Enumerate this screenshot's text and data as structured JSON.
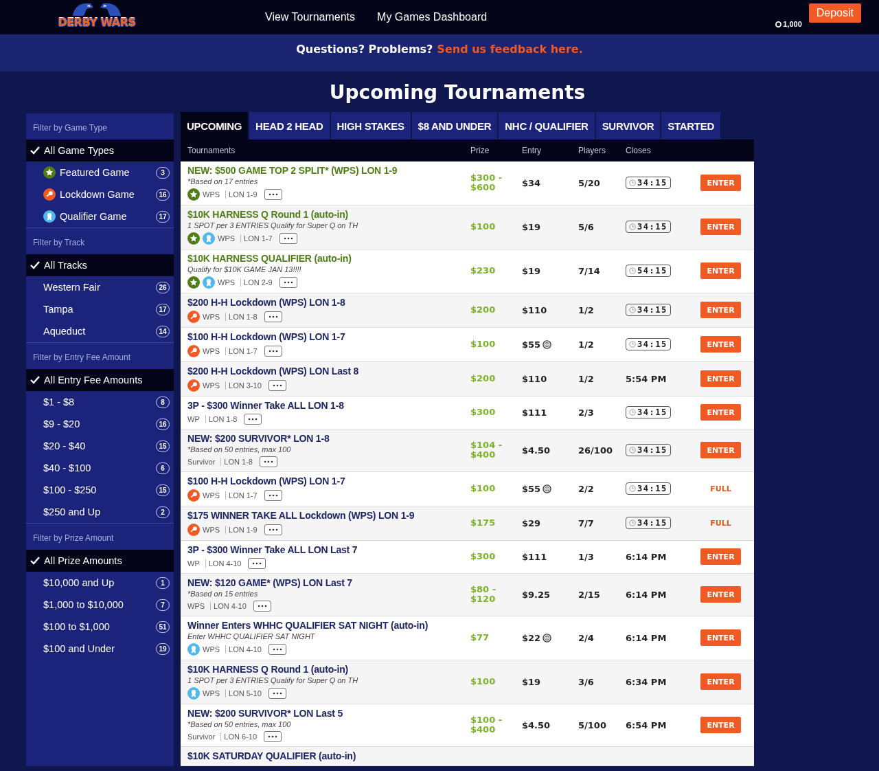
{
  "header": {
    "logo": "DERBY WARS",
    "nav": [
      "View Tournaments",
      "My Games Dashboard"
    ],
    "balance": "1,000",
    "deposit": "Deposit"
  },
  "banner": {
    "question": "Questions? Problems?",
    "link": "Send us feedback here."
  },
  "title": "Upcoming Tournaments",
  "sidebar": [
    {
      "heading": "Filter by Game Type",
      "items": [
        {
          "label": "All Game Types",
          "selected": true
        },
        {
          "label": "Featured Game",
          "kind": "featured",
          "count": "3",
          "selected": false
        },
        {
          "label": "Lockdown Game",
          "kind": "lockdown",
          "count": "16",
          "selected": false
        },
        {
          "label": "Qualifier Game",
          "kind": "qualifier",
          "count": "17",
          "selected": false
        }
      ]
    },
    {
      "heading": "Filter by Track",
      "items": [
        {
          "label": "All Tracks",
          "selected": true
        },
        {
          "label": "Western Fair",
          "count": "26",
          "selected": false
        },
        {
          "label": "Tampa",
          "count": "17",
          "selected": false
        },
        {
          "label": "Aqueduct",
          "count": "14",
          "selected": false
        }
      ]
    },
    {
      "heading": "Filter by Entry Fee Amount",
      "items": [
        {
          "label": "All Entry Fee Amounts",
          "selected": true
        },
        {
          "label": "$1 - $8",
          "count": "8",
          "selected": false
        },
        {
          "label": "$9 - $20",
          "count": "16",
          "selected": false
        },
        {
          "label": "$20 - $40",
          "count": "15",
          "selected": false
        },
        {
          "label": "$40 - $100",
          "count": "6",
          "selected": false
        },
        {
          "label": "$100 - $250",
          "count": "15",
          "selected": false
        },
        {
          "label": "$250 and Up",
          "count": "2",
          "selected": false
        }
      ]
    },
    {
      "heading": "Filter by Prize Amount",
      "items": [
        {
          "label": "All Prize Amounts",
          "selected": true
        },
        {
          "label": "$10,000 and Up",
          "count": "1",
          "selected": false
        },
        {
          "label": "$1,000 to $10,000",
          "count": "7",
          "selected": false
        },
        {
          "label": "$100 to $1,000",
          "count": "51",
          "selected": false
        },
        {
          "label": "$100 and Under",
          "count": "19",
          "selected": false
        }
      ]
    }
  ],
  "tabs": [
    {
      "label": "UPCOMING",
      "selected": true
    },
    {
      "label": "HEAD 2 HEAD",
      "selected": false
    },
    {
      "label": "HIGH STAKES",
      "selected": false
    },
    {
      "label": "$8 AND UNDER",
      "selected": false
    },
    {
      "label": "NHC / QUALIFIER",
      "selected": false
    },
    {
      "label": "SURVIVOR",
      "selected": false
    },
    {
      "label": "STARTED",
      "selected": false
    }
  ],
  "table": {
    "columns": [
      "Tournaments",
      "Prize",
      "Entry",
      "Players",
      "Closes"
    ],
    "rows": [
      {
        "title": "NEW: $500 GAME TOP 2 SPLIT* (WPS) LON 1-9",
        "featured": true,
        "note": "*Based on 17 entries",
        "badges": [
          {
            "kind": "featured"
          }
        ],
        "tags": [
          "WPS",
          "LON 1-9"
        ],
        "prize": "$300 - $600",
        "entry": "$34",
        "coin": false,
        "players": "5/20",
        "closes": {
          "kind": "countdown",
          "text": "34:15"
        },
        "action": {
          "kind": "enter",
          "label": "ENTER"
        }
      },
      {
        "title": "$10K HARNESS Q Round 1 (auto-in)",
        "featured": true,
        "note": "1 SPOT per 3 ENTRIES Qualify for Super Q on TH",
        "badges": [
          {
            "kind": "featured"
          },
          {
            "kind": "qualifier"
          }
        ],
        "tags": [
          "WPS",
          "LON 1-7"
        ],
        "prize": "$100",
        "entry": "$19",
        "coin": false,
        "players": "5/6",
        "closes": {
          "kind": "countdown",
          "text": "34:15"
        },
        "action": {
          "kind": "enter",
          "label": "ENTER"
        }
      },
      {
        "title": "$10K HARNESS QUALIFIER (auto-in)",
        "featured": true,
        "note": "Qualify for $10K GAME JAN 13!!!!",
        "badges": [
          {
            "kind": "featured"
          },
          {
            "kind": "qualifier"
          }
        ],
        "tags": [
          "WPS",
          "LON 2-9"
        ],
        "prize": "$230",
        "entry": "$19",
        "coin": false,
        "players": "7/14",
        "closes": {
          "kind": "countdown",
          "text": "54:15"
        },
        "action": {
          "kind": "enter",
          "label": "ENTER"
        }
      },
      {
        "title": "$200 H-H Lockdown (WPS) LON 1-8",
        "featured": false,
        "badges": [
          {
            "kind": "lockdown"
          }
        ],
        "tags": [
          "WPS",
          "LON 1-8"
        ],
        "prize": "$200",
        "entry": "$110",
        "coin": false,
        "players": "1/2",
        "closes": {
          "kind": "countdown",
          "text": "34:15"
        },
        "action": {
          "kind": "enter",
          "label": "ENTER"
        }
      },
      {
        "title": "$100 H-H Lockdown (WPS) LON 1-7",
        "featured": false,
        "badges": [
          {
            "kind": "lockdown"
          }
        ],
        "tags": [
          "WPS",
          "LON 1-7"
        ],
        "prize": "$100",
        "entry": "$55",
        "coin": true,
        "players": "1/2",
        "closes": {
          "kind": "countdown",
          "text": "34:15"
        },
        "action": {
          "kind": "enter",
          "label": "ENTER"
        }
      },
      {
        "title": "$200 H-H Lockdown (WPS) LON Last 8",
        "featured": false,
        "badges": [
          {
            "kind": "lockdown"
          }
        ],
        "tags": [
          "WPS",
          "LON 3-10"
        ],
        "prize": "$200",
        "entry": "$110",
        "coin": false,
        "players": "1/2",
        "closes": {
          "kind": "time",
          "text": "5:54 PM"
        },
        "action": {
          "kind": "enter",
          "label": "ENTER"
        }
      },
      {
        "title": "3P - $300 Winner Take ALL LON 1-8",
        "featured": false,
        "badges": [],
        "tags": [
          "WP",
          "LON 1-8"
        ],
        "prize": "$300",
        "entry": "$111",
        "coin": false,
        "players": "2/3",
        "closes": {
          "kind": "countdown",
          "text": "34:15"
        },
        "action": {
          "kind": "enter",
          "label": "ENTER"
        }
      },
      {
        "title": "NEW: $200 SURVIVOR* LON 1-8",
        "featured": false,
        "note": "*Based on 50 entries, max 100",
        "badges": [],
        "tags": [
          "Survivor",
          "LON 1-8"
        ],
        "prize": "$104 - $400",
        "entry": "$4.50",
        "coin": false,
        "players": "26/100",
        "closes": {
          "kind": "countdown",
          "text": "34:15"
        },
        "action": {
          "kind": "enter",
          "label": "ENTER"
        }
      },
      {
        "title": "$100 H-H Lockdown (WPS) LON 1-7",
        "featured": false,
        "badges": [
          {
            "kind": "lockdown"
          }
        ],
        "tags": [
          "WPS",
          "LON 1-7"
        ],
        "prize": "$100",
        "entry": "$55",
        "coin": true,
        "players": "2/2",
        "closes": {
          "kind": "countdown",
          "text": "34:15"
        },
        "action": {
          "kind": "full",
          "label": "FULL"
        }
      },
      {
        "title": "$175 WINNER TAKE ALL Lockdown (WPS) LON 1-9",
        "featured": false,
        "badges": [
          {
            "kind": "lockdown"
          }
        ],
        "tags": [
          "WPS",
          "LON 1-9"
        ],
        "prize": "$175",
        "entry": "$29",
        "coin": false,
        "players": "7/7",
        "closes": {
          "kind": "countdown",
          "text": "34:15"
        },
        "action": {
          "kind": "full",
          "label": "FULL"
        }
      },
      {
        "title": "3P - $300 Winner Take ALL LON Last 7",
        "featured": false,
        "badges": [],
        "tags": [
          "WP",
          "LON 4-10"
        ],
        "prize": "$300",
        "entry": "$111",
        "coin": false,
        "players": "1/3",
        "closes": {
          "kind": "time",
          "text": "6:14 PM"
        },
        "action": {
          "kind": "enter",
          "label": "ENTER"
        }
      },
      {
        "title": "NEW: $120 GAME* (WPS) LON Last 7",
        "featured": false,
        "note": "*Based on 15 entries",
        "badges": [],
        "tags": [
          "WPS",
          "LON 4-10"
        ],
        "prize": "$80 - $120",
        "entry": "$9.25",
        "coin": false,
        "players": "2/15",
        "closes": {
          "kind": "time",
          "text": "6:14 PM"
        },
        "action": {
          "kind": "enter",
          "label": "ENTER"
        }
      },
      {
        "title": "Winner Enters WHHC QUALIFIER SAT NIGHT (auto-in)",
        "featured": false,
        "note": "Enter WHHC QUALIFIER SAT NIGHT",
        "badges": [
          {
            "kind": "qualifier"
          }
        ],
        "tags": [
          "WPS",
          "LON 4-10"
        ],
        "prize": "$77",
        "entry": "$22",
        "coin": true,
        "players": "2/4",
        "closes": {
          "kind": "time",
          "text": "6:14 PM"
        },
        "action": {
          "kind": "enter",
          "label": "ENTER"
        }
      },
      {
        "title": "$10K HARNESS Q Round 1 (auto-in)",
        "featured": false,
        "note": "1 SPOT per 3 ENTRIES Qualify for Super Q on TH",
        "badges": [
          {
            "kind": "qualifier"
          }
        ],
        "tags": [
          "WPS",
          "LON 5-10"
        ],
        "prize": "$100",
        "entry": "$19",
        "coin": false,
        "players": "3/6",
        "closes": {
          "kind": "time",
          "text": "6:34 PM"
        },
        "action": {
          "kind": "enter",
          "label": "ENTER"
        }
      },
      {
        "title": "NEW: $200 SURVIVOR* LON Last 5",
        "featured": false,
        "note": "*Based on 50 entries, max 100",
        "badges": [],
        "tags": [
          "Survivor",
          "LON 6-10"
        ],
        "prize": "$100 - $400",
        "entry": "$4.50",
        "coin": false,
        "players": "5/100",
        "closes": {
          "kind": "time",
          "text": "6:54 PM"
        },
        "action": {
          "kind": "enter",
          "label": "ENTER"
        }
      },
      {
        "title": "$10K SATURDAY QUALIFIER (auto-in)",
        "featured": false
      }
    ]
  }
}
